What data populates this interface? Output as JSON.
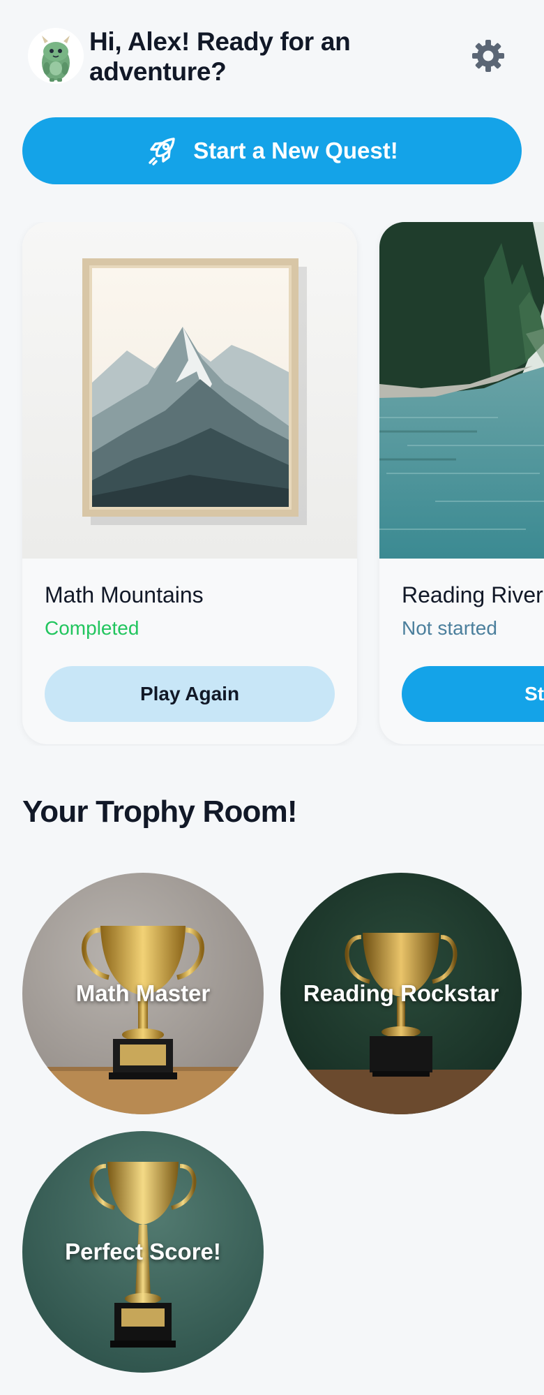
{
  "header": {
    "greeting": "Hi, Alex! Ready for an adventure?",
    "avatar_icon": "green-monster-icon",
    "settings_icon": "gear-icon"
  },
  "cta": {
    "label": "Start a New Quest!",
    "icon": "rocket-icon",
    "color": "#14a3e8"
  },
  "quests": [
    {
      "title": "Math Mountains",
      "status": "Completed",
      "status_color": "#22c55e",
      "button_label": "Play Again",
      "button_color": "#c8e6f7",
      "image": "framed-mountain-art"
    },
    {
      "title": "Reading River",
      "status": "Not started",
      "status_color": "#4b7f9c",
      "button_label": "Start",
      "button_color": "#14a3e8",
      "image": "forest-river"
    }
  ],
  "trophy_room": {
    "heading": "Your Trophy Room!",
    "trophies": [
      {
        "label": "Math Master",
        "image": "gold-trophy-grey-background"
      },
      {
        "label": "Reading Rockstar",
        "image": "gold-trophy-dark-green-background"
      },
      {
        "label": "Perfect Score!",
        "image": "gold-trophy-teal-background"
      }
    ]
  }
}
